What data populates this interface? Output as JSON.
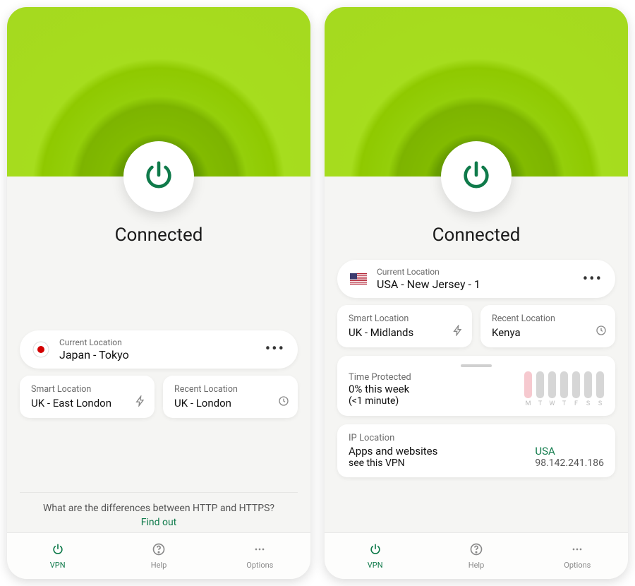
{
  "colors": {
    "accent": "#0f7a4a",
    "hero_green": "#8fc900"
  },
  "left": {
    "status": "Connected",
    "current": {
      "label": "Current Location",
      "value": "Japan - Tokyo",
      "flag_icon": "flag-japan"
    },
    "smart": {
      "label": "Smart Location",
      "value": "UK - East London"
    },
    "recent": {
      "label": "Recent Location",
      "value": "UK - London"
    },
    "tip": {
      "question": "What are the differences between HTTP and HTTPS?",
      "link": "Find out"
    },
    "nav": {
      "vpn": "VPN",
      "help": "Help",
      "options": "Options",
      "active": "vpn"
    }
  },
  "right": {
    "status": "Connected",
    "current": {
      "label": "Current Location",
      "value": "USA - New Jersey - 1",
      "flag_icon": "flag-usa"
    },
    "smart": {
      "label": "Smart Location",
      "value": "UK - Midlands"
    },
    "recent": {
      "label": "Recent Location",
      "value": "Kenya"
    },
    "time_protected": {
      "label": "Time Protected",
      "line1": "0% this week",
      "line2": "(<1 minute)",
      "days": [
        "M",
        "T",
        "W",
        "T",
        "F",
        "S",
        "S"
      ]
    },
    "ip": {
      "label": "IP Location",
      "line1": "Apps and websites",
      "line2": "see this VPN",
      "country": "USA",
      "address": "98.142.241.186"
    },
    "nav": {
      "vpn": "VPN",
      "help": "Help",
      "options": "Options",
      "active": "vpn"
    }
  }
}
